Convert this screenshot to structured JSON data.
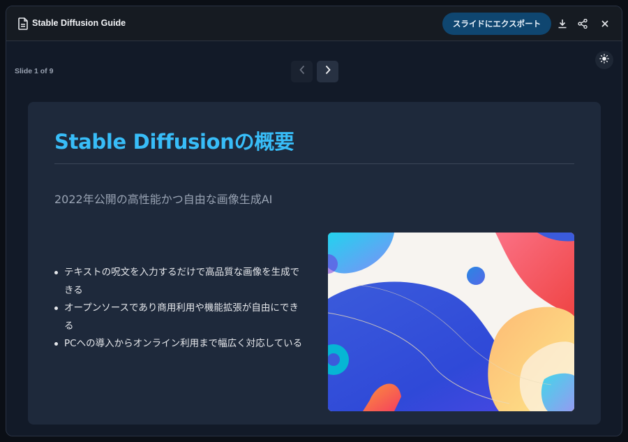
{
  "window": {
    "title": "Stable Diffusion Guide",
    "export_label": "スライドにエクスポート",
    "icons": [
      "document-icon",
      "download-icon",
      "share-icon",
      "close-icon"
    ]
  },
  "viewer": {
    "slide_counter": "Slide 1 of 9",
    "icons": [
      "chevron-left-icon",
      "chevron-right-icon",
      "sun-icon"
    ]
  },
  "slide": {
    "title": "Stable Diffusionの概要",
    "subtitle": "2022年公開の高性能かつ自由な画像生成AI",
    "bullets": [
      "テキストの呪文を入力するだけで高品質な画像を生成できる",
      "オープンソースであり商用利用や機能拡張が自由にできる",
      "PCへの導入からオンライン利用まで幅広く対応している"
    ],
    "image": "abstract-gradient-illustration"
  },
  "colors": {
    "accent": "#38bdf8",
    "export_button": "#0f4670",
    "slide_background": "#1e293b",
    "page_background": "#121a28"
  }
}
